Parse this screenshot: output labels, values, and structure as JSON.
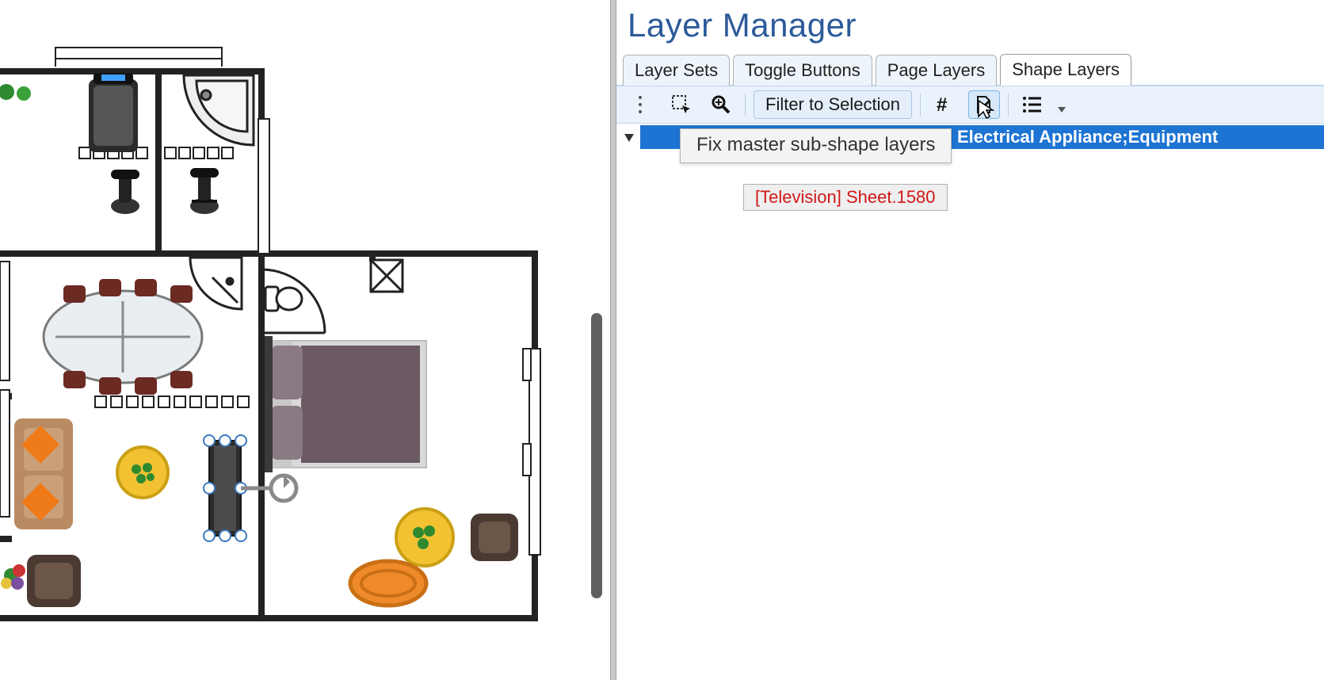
{
  "panel": {
    "title": "Layer Manager",
    "tabs": [
      {
        "id": "layer-sets",
        "label": "Layer Sets",
        "active": false
      },
      {
        "id": "toggle-buttons",
        "label": "Toggle Buttons",
        "active": false
      },
      {
        "id": "page-layers",
        "label": "Page Layers",
        "active": false
      },
      {
        "id": "shape-layers",
        "label": "Shape Layers",
        "active": true
      }
    ],
    "toolbar": {
      "filter_label": "Filter to Selection",
      "icons": {
        "grip": "grip-vertical-icon",
        "select_shapes": "select-shapes-icon",
        "zoom": "zoom-icon",
        "count": "hash-icon",
        "fix_master": "fix-master-icon",
        "list": "list-icon",
        "dropdown": "dropdown-icon"
      }
    },
    "tooltip": "Fix master sub-shape layers",
    "selected_row_label": "Electrical Appliance;Equipment",
    "child_row": {
      "master": "Television",
      "sheet": "Sheet.1580"
    }
  },
  "canvas": {
    "description": "Residential floor plan drawing with furniture shapes (treadmill, exercise bikes, dining table, sofa, armchairs, bed, bathtub, TV, rugs, plants).",
    "visible_shapes": [
      "treadmill",
      "corner-bathtub",
      "exercise-bike",
      "exercise-bike",
      "dining-table-oval",
      "chair",
      "chair",
      "chair",
      "chair",
      "chair",
      "chair",
      "chair",
      "chair",
      "shower-corner",
      "toilet",
      "double-bed",
      "bedside-table",
      "bedside-table",
      "sofa",
      "cushion",
      "cushion",
      "round-rug-yellow",
      "tv-unit",
      "rotation-handle",
      "armchair",
      "round-rug-yellow",
      "armchair",
      "oval-rug-orange",
      "window-segment",
      "door-swing",
      "plant",
      "plant",
      "plant"
    ]
  }
}
